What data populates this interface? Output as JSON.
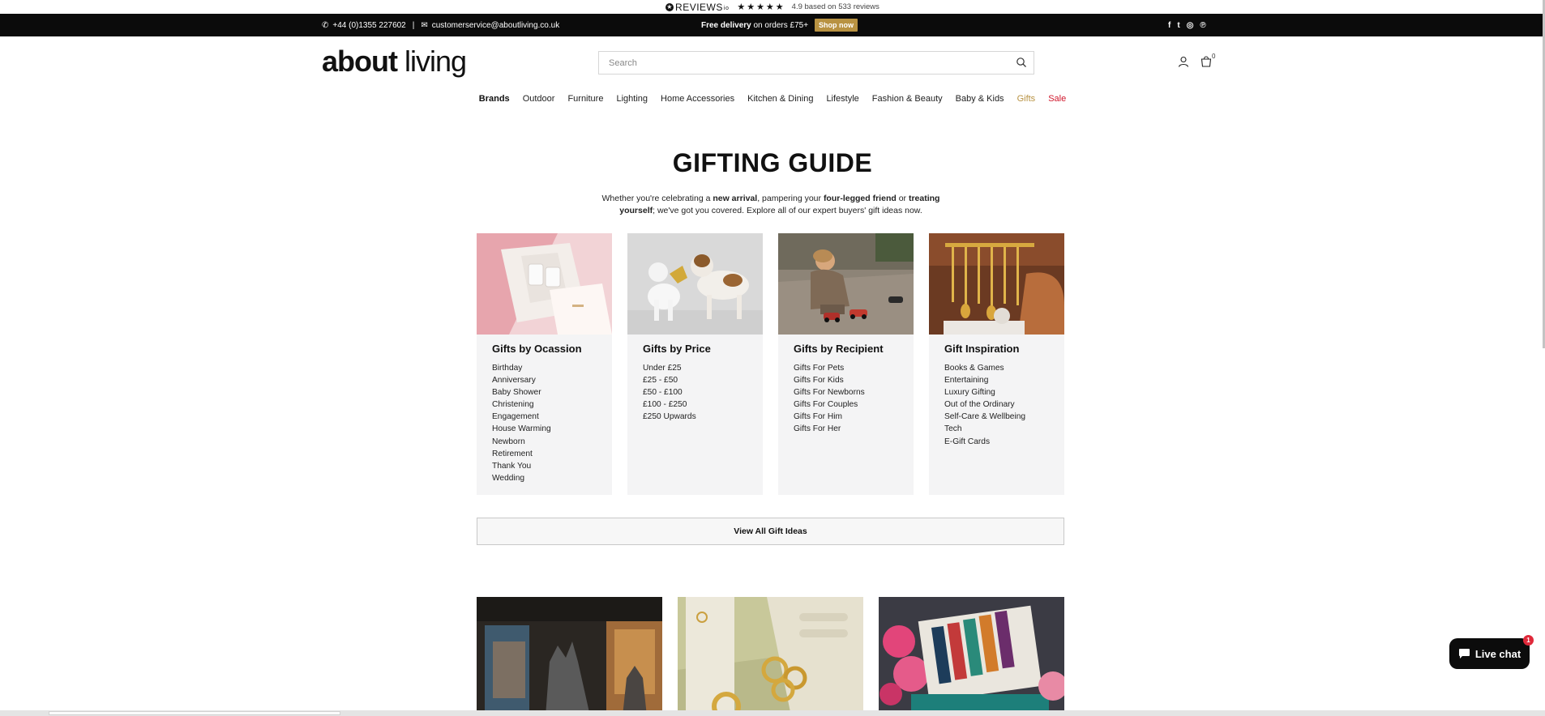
{
  "reviews": {
    "logo_text": "REVIEWS",
    "logo_suffix": "io",
    "stars": "★★★★★",
    "summary": "4.9 based on 533 reviews"
  },
  "announcement": {
    "phone": "+44 (0)1355 227602",
    "separator": "|",
    "email": "customerservice@aboutliving.co.uk",
    "promo_bold": "Free delivery",
    "promo_rest": " on orders £75+",
    "shop_now": "Shop now",
    "social_icons": [
      "facebook-icon",
      "twitter-icon",
      "instagram-icon",
      "pinterest-icon"
    ],
    "social_glyphs": [
      "f",
      "t",
      "◎",
      "℗"
    ]
  },
  "header": {
    "logo_bold": "about",
    "logo_light": " living",
    "search_placeholder": "Search",
    "cart_count": "0"
  },
  "nav": {
    "items": [
      {
        "label": "Brands",
        "color": "#111111",
        "bold": true
      },
      {
        "label": "Outdoor",
        "color": "#222222"
      },
      {
        "label": "Furniture",
        "color": "#222222"
      },
      {
        "label": "Lighting",
        "color": "#222222"
      },
      {
        "label": "Home Accessories",
        "color": "#222222"
      },
      {
        "label": "Kitchen & Dining",
        "color": "#222222"
      },
      {
        "label": "Lifestyle",
        "color": "#222222"
      },
      {
        "label": "Fashion & Beauty",
        "color": "#222222"
      },
      {
        "label": "Baby & Kids",
        "color": "#222222"
      },
      {
        "label": "Gifts",
        "color": "#b89242"
      },
      {
        "label": "Sale",
        "color": "#d0172c"
      }
    ]
  },
  "guide": {
    "title": "GIFTING GUIDE",
    "intro_1": "Whether you're celebrating a ",
    "intro_b1": "new arrival",
    "intro_2": ", pampering your ",
    "intro_b2": "four-legged friend",
    "intro_3": " or ",
    "intro_b3": "treating yourself",
    "intro_4": "; we've got you covered. Explore all of our expert buyers' gift ideas now."
  },
  "cards": [
    {
      "title": "Gifts by Ocassion",
      "links": [
        "Birthday",
        "Anniversary",
        "Baby Shower",
        "Christening",
        "Engagement",
        "House Warming",
        "Newborn",
        "Retirement",
        "Thank You",
        "Wedding"
      ]
    },
    {
      "title": "Gifts by Price",
      "links": [
        "Under £25",
        "£25 - £50",
        "£50 - £100",
        "£100 - £250",
        "£250 Upwards"
      ]
    },
    {
      "title": "Gifts by Recipient",
      "links": [
        "Gifts For Pets",
        "Gifts For Kids",
        "Gifts For Newborns",
        "Gifts For Couples",
        "Gifts For Him",
        "Gifts For Her"
      ]
    },
    {
      "title": "Gift Inspiration",
      "links": [
        "Books & Games",
        "Entertaining",
        "Luxury Gifting",
        "Out of the Ordinary",
        "Self-Care & Wellbeing",
        "Tech",
        "E-Gift Cards"
      ]
    }
  ],
  "view_all": "View All Gift Ideas",
  "chat": {
    "label": "Live chat",
    "badge": "1"
  }
}
